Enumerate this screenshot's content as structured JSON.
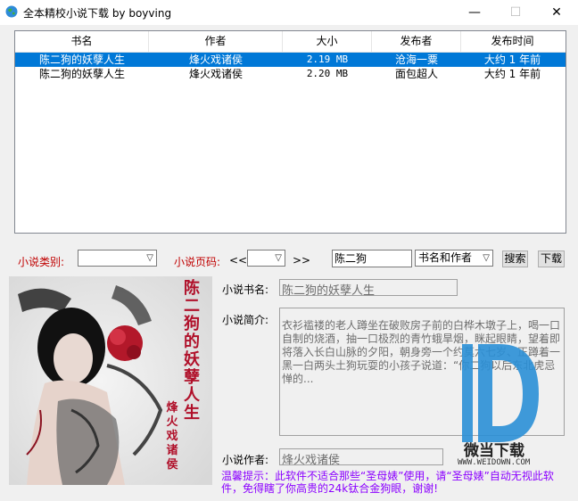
{
  "window": {
    "title": "全本精校小说下载 by boyving",
    "minimize": "—",
    "maximize": "☐",
    "close": "✕"
  },
  "table": {
    "headers": [
      "书名",
      "作者",
      "大小",
      "发布者",
      "发布时间"
    ],
    "rows": [
      {
        "name": "陈二狗的妖孽人生",
        "author": "烽火戏诸侯",
        "size": "2.19 MB",
        "publisher": "沧海一粟",
        "time": "大约 1 年前",
        "selected": true
      },
      {
        "name": "陈二狗的妖孽人生",
        "author": "烽火戏诸侯",
        "size": "2.20 MB",
        "publisher": "面包超人",
        "time": "大约 1 年前",
        "selected": false
      }
    ]
  },
  "filters": {
    "category_label": "小说类别:",
    "category_value": "",
    "page_label": "小说页码:",
    "prev": "<<",
    "page_value": "",
    "next": ">>",
    "search_value": "陈二狗",
    "search_mode": "书名和作者",
    "search_button": "搜索",
    "download_button": "下载"
  },
  "cover": {
    "title_chars": [
      "陈",
      "二",
      "狗",
      "的",
      "妖",
      "孽",
      "人",
      "生"
    ],
    "author_chars": [
      "烽",
      "火",
      "戏",
      "诸",
      "侯"
    ]
  },
  "details": {
    "name_label": "小说书名:",
    "name_value": "陈二狗的妖孽人生",
    "intro_label": "小说简介:",
    "intro_value": "衣衫褴褛的老人蹲坐在破败房子前的白桦木墩子上，喝一口自制的烧酒，抽一口极烈的青竹蛾旱烟，眯起眼睛，望着即将落入长白山脉的夕阳，朝身旁一个约莫六七岁、正蹲着一黑一白两头土狗玩耍的小孩子说道：“你二狗以后东北虎忌惮的...",
    "author_label": "小说作者:",
    "author_value": "烽火戏诸侯"
  },
  "tip": "温馨提示：此软件不适合那些“圣母婊”使用，请“圣母婊”自动无视此软件，免得瞎了你高贵的24k钛合金狗眼，谢谢!",
  "watermark": {
    "brand": "微当下载",
    "url": "WWW.WEIDOWN.COM"
  },
  "colors": {
    "selection": "#0078d7",
    "label_red": "#c00000",
    "tip_purple": "#8b00ff",
    "watermark_blue": "#2a8fd6"
  }
}
